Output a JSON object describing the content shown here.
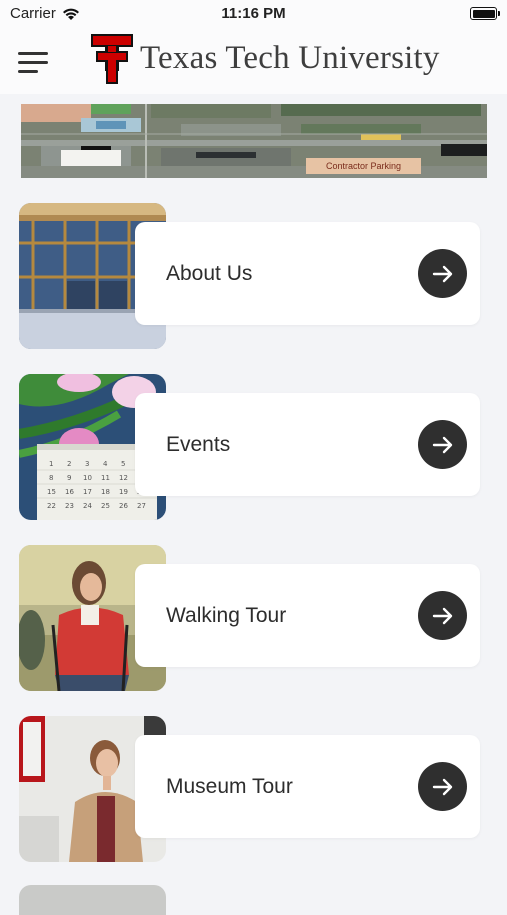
{
  "status_bar": {
    "carrier": "Carrier",
    "time": "11:16 PM"
  },
  "header": {
    "title": "Texas Tech University",
    "menu_icon": "hamburger-menu-icon",
    "logo": "double-t-logo"
  },
  "banner": {
    "parking_label": "Contractor Parking"
  },
  "menu_items": [
    {
      "label": "About Us",
      "image": "building-entrance-photo"
    },
    {
      "label": "Events",
      "image": "calendar-tulips-photo"
    },
    {
      "label": "Walking Tour",
      "image": "hiker-photo"
    },
    {
      "label": "Museum Tour",
      "image": "museum-visitor-photo"
    }
  ],
  "colors": {
    "brand_red": "#cc0000",
    "arrow_button": "#2f2f2f",
    "background": "#f3f4f7"
  }
}
